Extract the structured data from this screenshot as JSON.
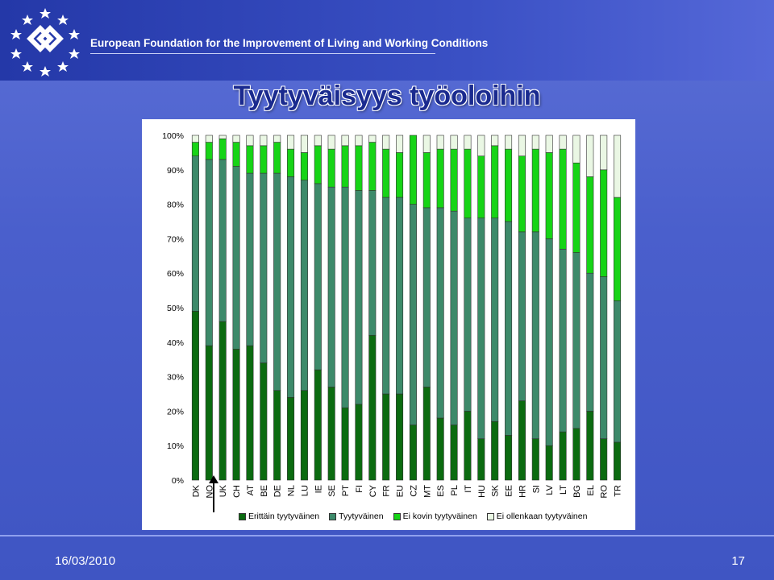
{
  "header": {
    "organization": "European Foundation for the Improvement of Living and Working Conditions"
  },
  "slide": {
    "title": "Tyytyväisyys työoloihin",
    "date": "16/03/2010",
    "page_number": "17"
  },
  "colors": {
    "series": [
      "#0b6b10",
      "#3d8a6a",
      "#16d416",
      "#eaf7e4"
    ]
  },
  "chart_data": {
    "type": "bar",
    "stacked": true,
    "percent": true,
    "categories": [
      "DK",
      "NO",
      "UK",
      "CH",
      "AT",
      "BE",
      "DE",
      "NL",
      "LU",
      "IE",
      "SE",
      "PT",
      "FI",
      "CY",
      "FR",
      "EU",
      "CZ",
      "MT",
      "ES",
      "PL",
      "IT",
      "HU",
      "SK",
      "EE",
      "HR",
      "SI",
      "LV",
      "LT",
      "BG",
      "EL",
      "RO",
      "TR"
    ],
    "series": [
      {
        "name": "Erittäin tyytyväinen",
        "values": [
          49,
          39,
          46,
          38,
          39,
          34,
          26,
          24,
          26,
          32,
          27,
          21,
          22,
          42,
          25,
          25,
          16,
          27,
          18,
          16,
          20,
          12,
          17,
          13,
          23,
          12,
          10,
          14,
          15,
          20,
          12,
          11
        ]
      },
      {
        "name": "Tyytyväinen",
        "values": [
          45,
          54,
          47,
          53,
          50,
          55,
          63,
          64,
          61,
          54,
          58,
          64,
          62,
          42,
          57,
          57,
          64,
          52,
          61,
          62,
          56,
          64,
          59,
          62,
          49,
          60,
          60,
          53,
          51,
          40,
          47,
          41
        ]
      },
      {
        "name": "Ei kovin tyytyväinen",
        "values": [
          4,
          5,
          6,
          7,
          8,
          8,
          9,
          8,
          8,
          11,
          11,
          12,
          13,
          14,
          14,
          13,
          20,
          16,
          17,
          18,
          20,
          18,
          21,
          21,
          22,
          24,
          25,
          29,
          26,
          28,
          31,
          30
        ]
      },
      {
        "name": "Ei ollenkaan tyytyväinen",
        "values": [
          2,
          2,
          1,
          2,
          3,
          3,
          2,
          4,
          5,
          3,
          4,
          3,
          3,
          2,
          4,
          5,
          0,
          5,
          4,
          4,
          4,
          6,
          3,
          4,
          6,
          4,
          5,
          4,
          8,
          12,
          10,
          18
        ]
      }
    ],
    "y_ticks": [
      "0%",
      "10%",
      "20%",
      "30%",
      "40%",
      "50%",
      "60%",
      "70%",
      "80%",
      "90%",
      "100%"
    ],
    "ylim": [
      0,
      100
    ],
    "legend_position": "bottom",
    "grid": false
  }
}
